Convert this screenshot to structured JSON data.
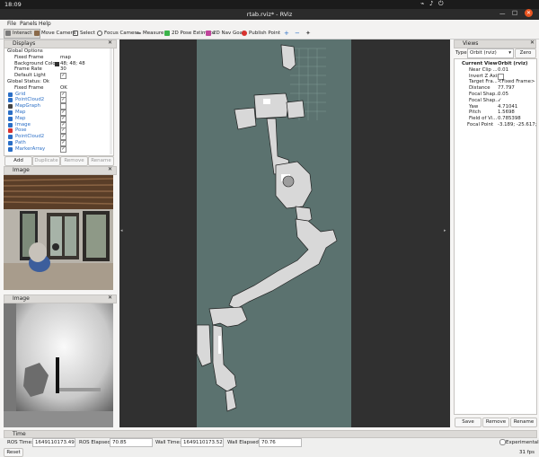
{
  "topbar": {
    "clock": "18:09"
  },
  "window": {
    "title": "rtab.rviz* - RViz"
  },
  "menu": [
    "File",
    "Panels",
    "Help"
  ],
  "toolbar": {
    "tools": [
      "Interact",
      "Move Camera",
      "Select",
      "Focus Camera",
      "Measure",
      "2D Pose Estimate",
      "2D Nav Goal",
      "Publish Point"
    ],
    "zoom_symbols": [
      "+",
      "−",
      "✦"
    ]
  },
  "displays": {
    "title": "Displays",
    "rows": [
      {
        "label": "Global Options",
        "value": ""
      },
      {
        "label": "Fixed Frame",
        "value": "map"
      },
      {
        "label": "Background Color",
        "value": "48; 48; 48"
      },
      {
        "label": "Frame Rate",
        "value": "30"
      },
      {
        "label": "Default Light",
        "value": "✓"
      },
      {
        "label": "Global Status: Ok",
        "value": ""
      },
      {
        "label": "Fixed Frame",
        "value": "OK"
      },
      {
        "label": "Grid",
        "value": "✓"
      },
      {
        "label": "PointCloud2",
        "value": "✓"
      },
      {
        "label": "MapGraph",
        "value": ""
      },
      {
        "label": "Map",
        "value": "✓"
      },
      {
        "label": "Map",
        "value": "✓"
      },
      {
        "label": "Image",
        "value": "✓"
      },
      {
        "label": "Pose",
        "value": "✓"
      },
      {
        "label": "PointCloud2",
        "value": "✓"
      },
      {
        "label": "Path",
        "value": "✓"
      },
      {
        "label": "MarkerArray",
        "value": "✓"
      }
    ],
    "buttons": [
      "Add",
      "Duplicate",
      "Remove",
      "Rename"
    ]
  },
  "image_panel_1": {
    "title": "Image"
  },
  "image_panel_2": {
    "title": "Image"
  },
  "views": {
    "title": "Views",
    "type_label": "Type:",
    "type_value": "Orbit (rviz)",
    "zero_button": "Zero",
    "rows": [
      {
        "label": "Current View",
        "value": "Orbit (rviz)"
      },
      {
        "label": "Near Clip ...",
        "value": "0.01"
      },
      {
        "label": "Invert Z Axis",
        "value": ""
      },
      {
        "label": "Target Fra...",
        "value": "<Fixed Frame>"
      },
      {
        "label": "Distance",
        "value": "77.797"
      },
      {
        "label": "Focal Shap...",
        "value": "0.05"
      },
      {
        "label": "Focal Shap...",
        "value": "✓"
      },
      {
        "label": "Yaw",
        "value": "4.71041"
      },
      {
        "label": "Pitch",
        "value": "1.5698"
      },
      {
        "label": "Field of Vi...",
        "value": "0.785398"
      },
      {
        "label": "Focal Point",
        "value": "-3.189; -25.617; 3.7..."
      }
    ],
    "buttons": [
      "Save",
      "Remove",
      "Rename"
    ]
  },
  "time": {
    "title": "Time",
    "ros_time_label": "ROS Time:",
    "ros_time": "1649110173.49",
    "ros_elapsed_label": "ROS Elapsed:",
    "ros_elapsed": "70.85",
    "wall_time_label": "Wall Time:",
    "wall_time": "1649110173.52",
    "wall_elapsed_label": "Wall Elapsed:",
    "wall_elapsed": "70.76",
    "experimental_label": "Experimental",
    "reset_button": "Reset",
    "fps": "31 fps"
  },
  "colors": {
    "background": "#303030",
    "map_free": "#d8d8d8",
    "map_unknown": "#5b726f",
    "accent": "#2a6ec6"
  }
}
